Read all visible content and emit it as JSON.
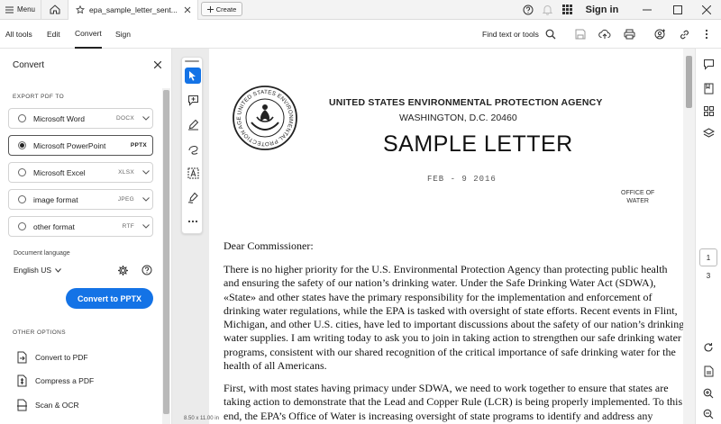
{
  "titlebar": {
    "menu_label": "Menu",
    "tab_title": "epa_sample_letter_sent...",
    "create_label": "Create",
    "signin_label": "Sign in"
  },
  "toolbar": {
    "tabs": [
      {
        "label": "All tools"
      },
      {
        "label": "Edit"
      },
      {
        "label": "Convert"
      },
      {
        "label": "Sign"
      }
    ],
    "active_tab": "Convert",
    "find_label": "Find text or tools"
  },
  "panel": {
    "title": "Convert",
    "export_heading": "EXPORT PDF TO",
    "options": [
      {
        "label": "Microsoft Word",
        "ext": "DOCX",
        "selected": false
      },
      {
        "label": "Microsoft PowerPoint",
        "ext": "PPTX",
        "selected": true
      },
      {
        "label": "Microsoft Excel",
        "ext": "XLSX",
        "selected": false
      },
      {
        "label": "image format",
        "ext": "JPEG",
        "selected": false
      },
      {
        "label": "other format",
        "ext": "RTF",
        "selected": false
      }
    ],
    "doc_lang_label": "Document language",
    "doc_lang_value": "English US",
    "convert_button": "Convert to PPTX",
    "other_heading": "OTHER OPTIONS",
    "other_options": [
      {
        "label": "Convert to PDF",
        "icon": "document-convert-icon"
      },
      {
        "label": "Compress a PDF",
        "icon": "compress-icon"
      },
      {
        "label": "Scan & OCR",
        "icon": "scan-icon"
      }
    ]
  },
  "document": {
    "page_size": "8.50 x 11.00 in",
    "agency": "UNITED STATES ENVIRONMENTAL PROTECTION AGENCY",
    "address": "WASHINGTON, D.C. 20460",
    "title": "SAMPLE LETTER",
    "stamp_date": "FEB - 9 2016",
    "office_line1": "OFFICE OF",
    "office_line2": "WATER",
    "salutation": "Dear Commissioner:",
    "para1": "There is no higher priority for the U.S. Environmental Protection Agency than protecting public health and ensuring the safety of our nation’s drinking water. Under the Safe Drinking Water Act (SDWA), «State» and other states have the primary responsibility for the implementation and enforcement of drinking water regulations, while the EPA is tasked with oversight of state efforts. Recent events in Flint, Michigan, and other U.S. cities, have led to important discussions about the safety of our nation’s drinking water supplies. I am writing today to ask you to join in taking action to strengthen our safe drinking water programs, consistent with our shared recognition of the critical importance of safe drinking water for the health of all Americans.",
    "para2": "First, with most states having primacy under SDWA, we need to work together to ensure that states are taking action to demonstrate that the Lead and Copper Rule (LCR) is being properly implemented. To this end, the EPA’s Office of Water is increasing oversight of state programs to identify and address any",
    "seal_text": "UNITED STATES ENVIRONMENTAL PROTECTION AGENCY"
  },
  "pager": {
    "current": "1",
    "total": "3"
  },
  "colors": {
    "accent": "#1473e6"
  }
}
